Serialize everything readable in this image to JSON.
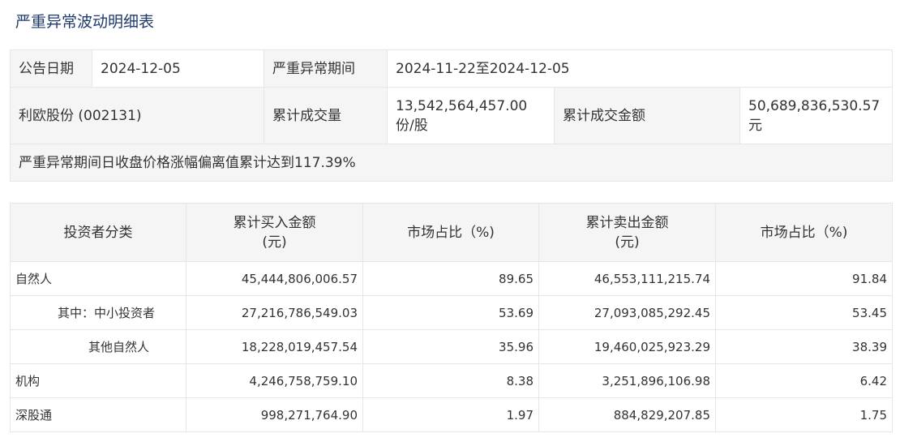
{
  "title": "严重异常波动明细表",
  "info": {
    "announce_date_label": "公告日期",
    "announce_date": "2024-12-05",
    "period_label": "严重异常期间",
    "period": "2024-11-22至2024-12-05",
    "stock": "利欧股份 (002131)",
    "volume_label": "累计成交量",
    "volume": "13,542,564,457.00 份/股",
    "amount_label": "累计成交金额",
    "amount": "50,689,836,530.57 元",
    "note": "严重异常期间日收盘价格涨幅偏离值累计达到117.39%"
  },
  "table": {
    "headers": [
      "投资者分类",
      "累计买入金额\n(元)",
      "市场占比（%)",
      "累计卖出金额\n(元)",
      "市场占比（%)"
    ],
    "rows": [
      {
        "category": "自然人",
        "buy": "45,444,806,006.57",
        "buy_pct": "89.65",
        "sell": "46,553,111,215.74",
        "sell_pct": "91.84"
      },
      {
        "category": "其中：中小投资者",
        "buy": "27,216,786,549.03",
        "buy_pct": "53.69",
        "sell": "27,093,085,292.45",
        "sell_pct": "53.45"
      },
      {
        "category": "其他自然人",
        "buy": "18,228,019,457.54",
        "buy_pct": "35.96",
        "sell": "19,460,025,923.29",
        "sell_pct": "38.39"
      },
      {
        "category": "机构",
        "buy": "4,246,758,759.10",
        "buy_pct": "8.38",
        "sell": "3,251,896,106.98",
        "sell_pct": "6.42"
      },
      {
        "category": "深股通",
        "buy": "998,271,764.90",
        "buy_pct": "1.97",
        "sell": "884,829,207.85",
        "sell_pct": "1.75"
      }
    ]
  }
}
